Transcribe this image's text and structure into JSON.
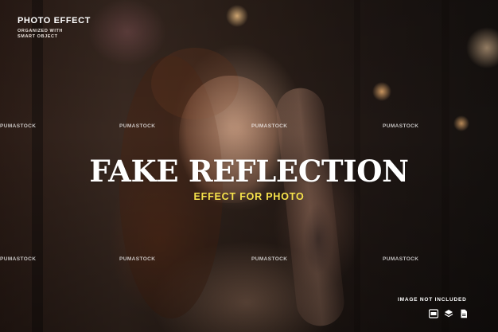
{
  "brand": {
    "title": "PHOTO EFFECT",
    "subtitle_line1": "ORGANIZED WITH",
    "subtitle_line2": "SMART OBJECT"
  },
  "headline": "FAKE REFLECTION",
  "subheadline": "EFFECT FOR PHOTO",
  "watermark": "PUMASTOCK",
  "footer": {
    "note": "IMAGE NOT INCLUDED",
    "icons": [
      "photoshop-file-icon",
      "layers-icon",
      "document-icon"
    ]
  },
  "colors": {
    "headline": "#ffffff",
    "subheadline": "#f7e34b"
  }
}
